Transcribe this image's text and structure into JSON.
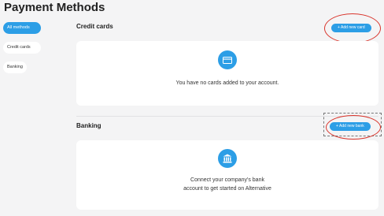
{
  "page": {
    "title": "Payment Methods"
  },
  "sidebar": {
    "items": [
      {
        "label": "All methods",
        "active": true
      },
      {
        "label": "Credit cards",
        "active": false
      },
      {
        "label": "Banking",
        "active": false
      }
    ]
  },
  "credit_cards": {
    "heading": "Credit cards",
    "add_label": "+ Add new card",
    "empty_text": "You have no cards added to your account.",
    "icon": "credit-card-icon"
  },
  "banking": {
    "heading": "Banking",
    "add_label": "+ Add new bank",
    "empty_text_line1": "Connect your company's bank",
    "empty_text_line2": "account to get started on Alternative",
    "icon": "bank-icon"
  },
  "colors": {
    "accent": "#2c9ee6",
    "highlight": "#d9342b",
    "background": "#f4f4f5"
  }
}
